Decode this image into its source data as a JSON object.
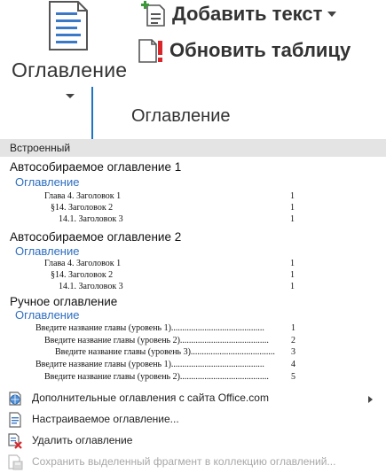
{
  "ribbon": {
    "toc_button_label": "Оглавление",
    "add_text_label": "Добавить текст",
    "update_table_label": "Обновить таблицу",
    "group_label": "Оглавление"
  },
  "gallery": {
    "section_label": "Встроенный",
    "auto1": {
      "title": "Автособираемое оглавление 1",
      "heading": "Оглавление",
      "entries": [
        {
          "text": "Глава 4. Заголовок 1",
          "page": "1"
        },
        {
          "text": "§14. Заголовок 2",
          "page": "1"
        },
        {
          "text": "14.1. Заголовок 3",
          "page": "1"
        }
      ]
    },
    "auto2": {
      "title": "Автособираемое оглавление 2",
      "heading": "Оглавление",
      "entries": [
        {
          "text": "Глава 4. Заголовок 1",
          "page": "1"
        },
        {
          "text": "§14. Заголовок 2",
          "page": "1"
        },
        {
          "text": "14.1. Заголовок 3",
          "page": "1"
        }
      ]
    },
    "manual": {
      "title": "Ручное оглавление",
      "heading": "Оглавление",
      "entries": [
        {
          "text": "Введите название главы (уровень 1)..........................................",
          "page": "1"
        },
        {
          "text": "Введите название главы (уровень 2)........................................",
          "page": "2"
        },
        {
          "text": "Введите название главы (уровень 3)......................................",
          "page": "3"
        },
        {
          "text": "Введите название главы (уровень 1)..........................................",
          "page": "4"
        },
        {
          "text": "Введите название главы (уровень 2)........................................",
          "page": "5"
        }
      ]
    }
  },
  "menu": {
    "more_from_office": "Дополнительные оглавления с сайта Office.com",
    "custom_toc": "Настраиваемое оглавление...",
    "remove_toc": "Удалить оглавление",
    "save_selection": "Сохранить выделенный фрагмент в коллекцию оглавлений..."
  },
  "colors": {
    "accent_blue": "#2d6ec0",
    "arrow_blue": "#1b74c4",
    "section_bg": "#e4e4e4",
    "disabled_text": "#a8a8a8",
    "update_icon_red": "#d8262b",
    "add_icon_green": "#3a9a3a"
  }
}
